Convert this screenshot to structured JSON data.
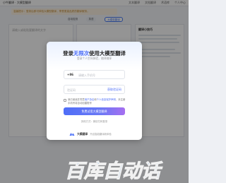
{
  "app": {
    "title": "小牛翻译 · 大模型翻译",
    "nav": [
      "文本翻译",
      "文档翻译",
      "术语库",
      "个人中心"
    ],
    "notice": "温馨提示：登录后即可体验大模型翻译，享受更高品质的翻译服务。",
    "toolbar": {
      "source_lang": "自动检测",
      "target_lang": "英语",
      "model_button": "大模型翻译"
    },
    "input_placeholder": "请输入或粘贴要翻译的文字",
    "side_panel_title": "翻译小技巧"
  },
  "modal": {
    "title_prefix": "登录",
    "title_accent": "无限次",
    "title_suffix": "使用大模型翻译",
    "subtitle": "登录个人空间体验，随译随享",
    "phone_prefix": "+86",
    "phone_placeholder": "请输入手机号",
    "code_placeholder": "验证码",
    "get_code_label": "获取验证码",
    "agree_text_1": "我已阅读并同意",
    "agree_link_1": "用户协议",
    "agree_text_2": "和",
    "agree_link_2": "个人信息保护声明",
    "agree_text_3": "，未注册手机号将自动创建账号",
    "login_button": "免费试用大模型翻译",
    "alt_login": "其他方式：微信扫码登录",
    "brand_name": "大模翻译",
    "brand_slogan": "开启智能翻译新体验"
  },
  "watermark": {
    "text": "百库自动话"
  },
  "colors": {
    "accent": "#4a6cf7",
    "button_gradient_end": "#a66ff0",
    "watermark": "#2f8be6"
  }
}
